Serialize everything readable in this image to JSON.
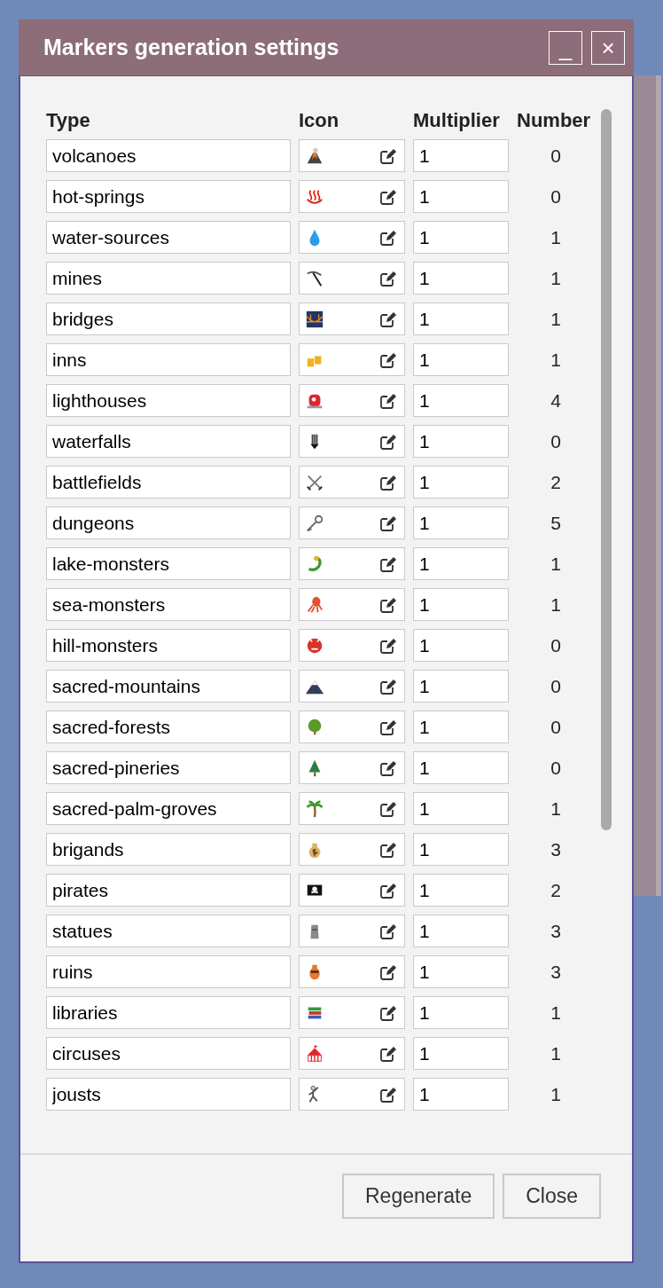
{
  "dialog": {
    "title": "Markers generation settings",
    "title_buttons": [
      "_",
      "×"
    ]
  },
  "columns": [
    "Type",
    "Icon",
    "Multiplier",
    "Number"
  ],
  "markers": [
    {
      "type": "volcanoes",
      "multiplier": "1",
      "number": "0"
    },
    {
      "type": "hot-springs",
      "multiplier": "1",
      "number": "0"
    },
    {
      "type": "water-sources",
      "multiplier": "1",
      "number": "1"
    },
    {
      "type": "mines",
      "multiplier": "1",
      "number": "1"
    },
    {
      "type": "bridges",
      "multiplier": "1",
      "number": "1"
    },
    {
      "type": "inns",
      "multiplier": "1",
      "number": "1"
    },
    {
      "type": "lighthouses",
      "multiplier": "1",
      "number": "4"
    },
    {
      "type": "waterfalls",
      "multiplier": "1",
      "number": "0"
    },
    {
      "type": "battlefields",
      "multiplier": "1",
      "number": "2"
    },
    {
      "type": "dungeons",
      "multiplier": "1",
      "number": "5"
    },
    {
      "type": "lake-monsters",
      "multiplier": "1",
      "number": "1"
    },
    {
      "type": "sea-monsters",
      "multiplier": "1",
      "number": "1"
    },
    {
      "type": "hill-monsters",
      "multiplier": "1",
      "number": "0"
    },
    {
      "type": "sacred-mountains",
      "multiplier": "1",
      "number": "0"
    },
    {
      "type": "sacred-forests",
      "multiplier": "1",
      "number": "0"
    },
    {
      "type": "sacred-pineries",
      "multiplier": "1",
      "number": "0"
    },
    {
      "type": "sacred-palm-groves",
      "multiplier": "1",
      "number": "1"
    },
    {
      "type": "brigands",
      "multiplier": "1",
      "number": "3"
    },
    {
      "type": "pirates",
      "multiplier": "1",
      "number": "2"
    },
    {
      "type": "statues",
      "multiplier": "1",
      "number": "3"
    },
    {
      "type": "ruins",
      "multiplier": "1",
      "number": "3"
    },
    {
      "type": "libraries",
      "multiplier": "1",
      "number": "1"
    },
    {
      "type": "circuses",
      "multiplier": "1",
      "number": "1"
    },
    {
      "type": "jousts",
      "multiplier": "1",
      "number": "1"
    }
  ],
  "buttons": [
    "Regenerate",
    "Close"
  ]
}
